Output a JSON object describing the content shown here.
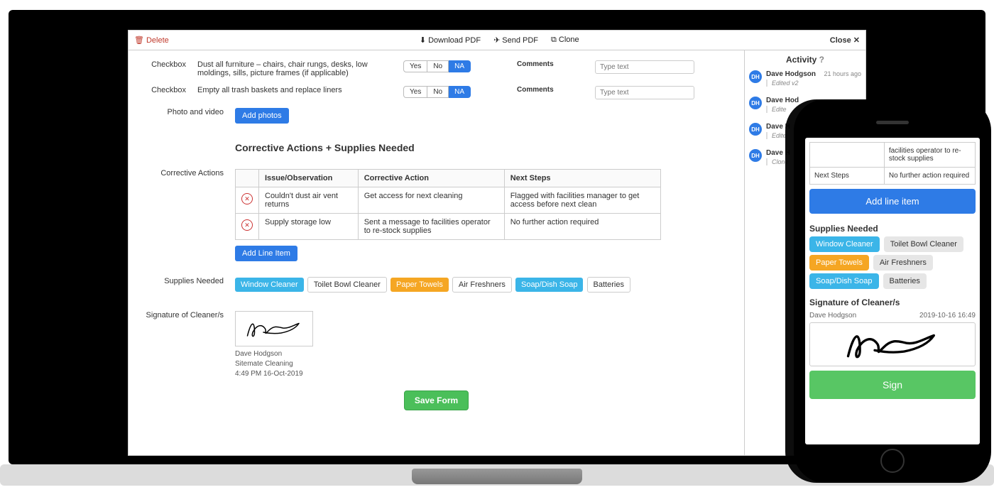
{
  "toolbar": {
    "delete": "Delete",
    "download_pdf": "Download PDF",
    "send_pdf": "Send PDF",
    "clone": "Clone",
    "close": "Close"
  },
  "checkbox_label": "Checkbox",
  "check1_text": "Dust all furniture – chairs, chair rungs, desks, low moldings, sills, picture frames (if applicable)",
  "check2_text": "Empty all trash baskets and replace liners",
  "choices": {
    "yes": "Yes",
    "no": "No",
    "na": "NA"
  },
  "comments_label": "Comments",
  "text_placeholder": "Type text",
  "photo_label": "Photo and video",
  "add_photos": "Add photos",
  "section_title": "Corrective Actions + Supplies Needed",
  "ca_label": "Corrective Actions",
  "ca_headers": {
    "issue": "Issue/Observation",
    "action": "Corrective Action",
    "next": "Next Steps"
  },
  "ca_rows": [
    {
      "issue": "Couldn't dust air vent returns",
      "action": "Get access for next cleaning",
      "next": "Flagged with facilities manager to get access before next clean"
    },
    {
      "issue": "Supply storage low",
      "action": "Sent a message to facilities operator to re-stock supplies",
      "next": "No further action required"
    }
  ],
  "add_line_item": "Add Line Item",
  "supplies_label": "Supplies Needed",
  "supplies": {
    "window": "Window Cleaner",
    "tb": "Toilet Bowl Cleaner",
    "paper": "Paper Towels",
    "air": "Air Freshners",
    "soap": "Soap/Dish Soap",
    "batt": "Batteries"
  },
  "signature_label": "Signature of Cleaner/s",
  "signature": {
    "name": "Dave Hodgson",
    "company": "Sitemate Cleaning",
    "time": "4:49 PM 16-Oct-2019"
  },
  "save_form": "Save Form",
  "activity": {
    "title": "Activity",
    "initials": "DH",
    "items": [
      {
        "name": "Dave Hodgson",
        "time": "21 hours ago",
        "desc": "Edited v2"
      },
      {
        "name": "Dave Hod",
        "time": "",
        "desc": "Edite"
      },
      {
        "name": "Dave H",
        "time": "",
        "desc": "Edite"
      },
      {
        "name": "Dave H",
        "time": "",
        "desc": "Clone"
      }
    ]
  },
  "phone": {
    "row1_action_partial": "facilities operator to re-stock supplies",
    "row1_next_label": "Next Steps",
    "row1_next_val": "No further action required",
    "add_line_item": "Add line item",
    "supplies_title": "Supplies Needed",
    "sig_title": "Signature of Cleaner/s",
    "sig_name": "Dave  Hodgson",
    "sig_time": "2019-10-16 16:49",
    "sign": "Sign"
  }
}
